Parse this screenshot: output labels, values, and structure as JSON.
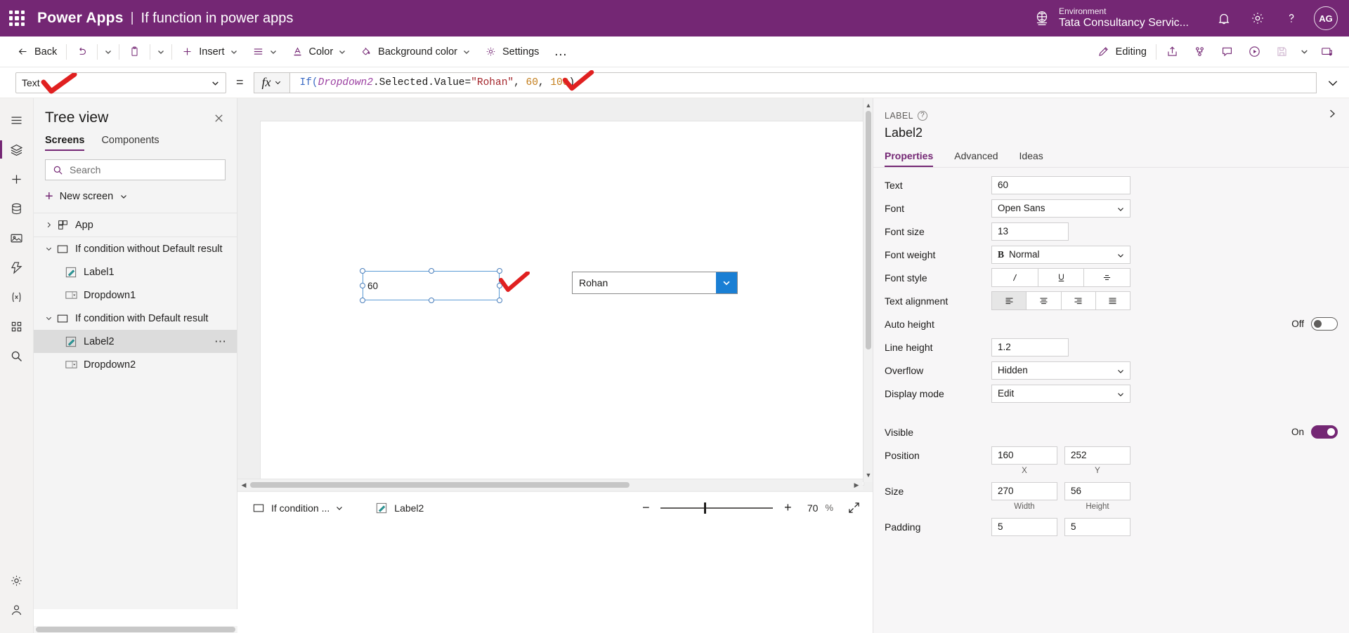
{
  "topbar": {
    "waffle_icon": "waffle-grid-icon",
    "brand": "Power Apps",
    "separator": "|",
    "app_title": "If function in power apps",
    "environment_label": "Environment",
    "environment_name": "Tata Consultancy Servic...",
    "environment_icon": "globe-environment-icon",
    "notification_icon": "bell-icon",
    "settings_icon": "gear-icon",
    "help_icon": "question-mark-icon",
    "avatar_initials": "AG",
    "background_color": "#742774"
  },
  "commandbar": {
    "back": "Back",
    "undo_icon": "undo-icon",
    "paste_icon": "clipboard-paste-icon",
    "insert": "Insert",
    "align_icon": "align-lines-icon",
    "color": "Color",
    "background_color": "Background color",
    "settings": "Settings",
    "overflow": "…",
    "editing": "Editing",
    "share_icon": "share-icon",
    "checker_icon": "app-checker-icon",
    "comment_icon": "comment-icon",
    "play_icon": "play-preview-icon",
    "save_icon": "save-icon",
    "save_chevron_icon": "chevron-down-icon",
    "publish_icon": "publish-icon"
  },
  "formulabar": {
    "property": "Text",
    "equals": "=",
    "fx_label": "fx",
    "formula_tokens": [
      {
        "t": "If(",
        "k": "fn"
      },
      {
        "t": "Dropdown2",
        "k": "ctl"
      },
      {
        "t": ".Selected.Value=",
        "k": "plain"
      },
      {
        "t": "\"Rohan\"",
        "k": "str"
      },
      {
        "t": ", ",
        "k": "plain"
      },
      {
        "t": "60",
        "k": "num"
      },
      {
        "t": ", ",
        "k": "plain"
      },
      {
        "t": "100",
        "k": "num"
      },
      {
        "t": ")",
        "k": "plain"
      }
    ],
    "formula_plain": "If(Dropdown2.Selected.Value=\"Rohan\", 60, 100)",
    "collapse_icon": "chevron-down-icon"
  },
  "rail": {
    "items": [
      {
        "name": "hamburger-menu-icon",
        "active": false
      },
      {
        "name": "tree-view-layers-icon",
        "active": true
      },
      {
        "name": "insert-plus-icon",
        "active": false
      },
      {
        "name": "data-sources-icon",
        "active": false
      },
      {
        "name": "media-icon",
        "active": false
      },
      {
        "name": "power-automate-icon",
        "active": false
      },
      {
        "name": "variables-icon",
        "active": false
      },
      {
        "name": "app-checker-icon",
        "active": false
      },
      {
        "name": "search-icon",
        "active": false
      }
    ],
    "bottom": [
      {
        "name": "settings-gear-icon"
      },
      {
        "name": "account-icon"
      }
    ]
  },
  "treeview": {
    "title": "Tree view",
    "close_icon": "close-icon",
    "tabs": [
      {
        "label": "Screens",
        "active": true
      },
      {
        "label": "Components",
        "active": false
      }
    ],
    "search_placeholder": "Search",
    "search_icon": "search-icon",
    "new_screen": "New screen",
    "nodes": [
      {
        "label": "App",
        "icon": "app-grid-icon",
        "caret": "collapsed",
        "level": 0,
        "selected": false
      },
      {
        "label": "If condition without Default result",
        "icon": "screen-icon",
        "caret": "expanded",
        "level": 0,
        "selected": false
      },
      {
        "label": "Label1",
        "icon": "label-icon",
        "caret": "none",
        "level": 1,
        "selected": false
      },
      {
        "label": "Dropdown1",
        "icon": "dropdown-icon",
        "caret": "none",
        "level": 1,
        "selected": false
      },
      {
        "label": "If condition with Default result",
        "icon": "screen-icon",
        "caret": "expanded",
        "level": 0,
        "selected": false
      },
      {
        "label": "Label2",
        "icon": "label-icon",
        "caret": "none",
        "level": 1,
        "selected": true,
        "more": "⋯"
      },
      {
        "label": "Dropdown2",
        "icon": "dropdown-icon",
        "caret": "none",
        "level": 1,
        "selected": false
      }
    ]
  },
  "canvas": {
    "label_text": "60",
    "dropdown_text": "Rohan",
    "dropdown_arrow_icon": "chevron-down-icon"
  },
  "statusbar": {
    "screen_crumb": "If condition ...",
    "screen_icon": "screen-icon",
    "screen_chevron_icon": "chevron-down-icon",
    "control_crumb": "Label2",
    "control_icon": "label-icon",
    "zoom_out_icon": "minus-icon",
    "zoom_in_icon": "plus-icon",
    "zoom_value": "70",
    "zoom_unit": "%",
    "fullscreen_icon": "expand-fullscreen-icon"
  },
  "properties": {
    "kind": "LABEL",
    "help_icon": "help-question-icon",
    "expand_icon": "chevron-right-icon",
    "control_name": "Label2",
    "tabs": [
      {
        "label": "Properties",
        "active": true
      },
      {
        "label": "Advanced",
        "active": false
      },
      {
        "label": "Ideas",
        "active": false
      }
    ],
    "rows": [
      {
        "label": "Text",
        "type": "text",
        "value": "60"
      },
      {
        "label": "Font",
        "type": "select",
        "value": "Open Sans"
      },
      {
        "label": "Font size",
        "type": "text",
        "value": "13",
        "narrow": true
      },
      {
        "label": "Font weight",
        "type": "select",
        "value": "Normal",
        "prefix": "B"
      },
      {
        "label": "Font style",
        "type": "segment",
        "options": [
          "I",
          "U",
          "S"
        ],
        "active_index": -1
      },
      {
        "label": "Text alignment",
        "type": "segment",
        "options": [
          "align-left",
          "align-center",
          "align-right",
          "align-justify"
        ],
        "active_index": 0
      },
      {
        "label": "Auto height",
        "type": "toggle",
        "state_label": "Off",
        "on": false
      },
      {
        "label": "Line height",
        "type": "text",
        "value": "1.2",
        "narrow": true
      },
      {
        "label": "Overflow",
        "type": "select",
        "value": "Hidden"
      },
      {
        "label": "Display mode",
        "type": "select",
        "value": "Edit"
      }
    ],
    "rows2": [
      {
        "label": "Visible",
        "type": "toggle",
        "state_label": "On",
        "on": true
      },
      {
        "label": "Position",
        "type": "pair",
        "value_x": "160",
        "value_y": "252",
        "cap_a": "X",
        "cap_b": "Y"
      },
      {
        "label": "Size",
        "type": "pair",
        "value_x": "270",
        "value_y": "56",
        "cap_a": "Width",
        "cap_b": "Height"
      },
      {
        "label": "Padding",
        "type": "pair",
        "value_x": "5",
        "value_y": "5",
        "cap_a": "",
        "cap_b": ""
      }
    ]
  },
  "annotations": {
    "color": "#e03030",
    "marks": [
      "checkmark-near-property-selector",
      "checkmark-near-formula-end",
      "checkmark-near-canvas-label"
    ]
  }
}
